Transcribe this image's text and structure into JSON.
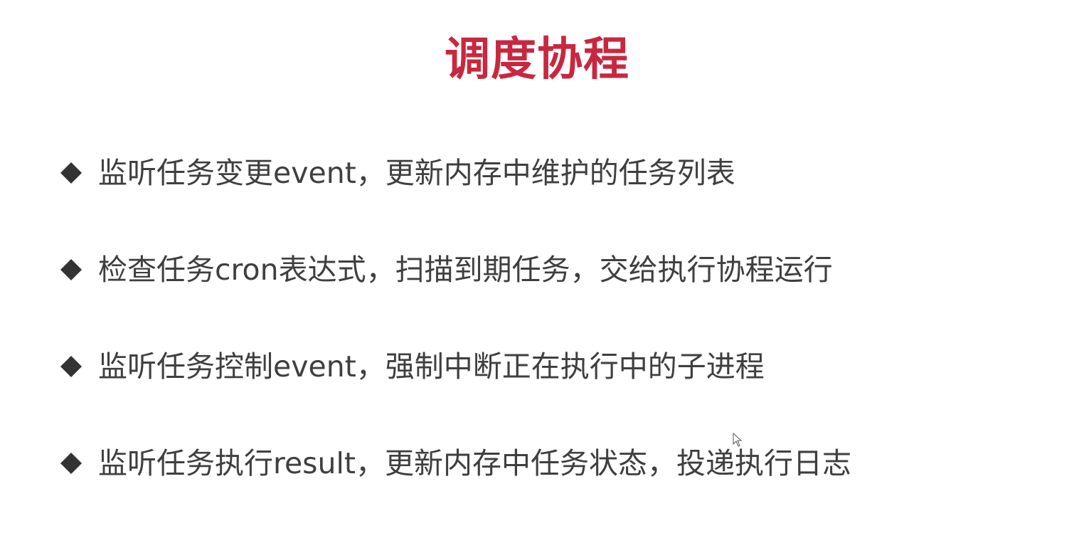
{
  "slide": {
    "title": "调度协程",
    "title_color": "#c8283f",
    "bullet_icon": "diamond-bullet-icon",
    "bullet_color": "#333333",
    "bullets": [
      "监听任务变更event，更新内存中维护的任务列表",
      "检查任务cron表达式，扫描到期任务，交给执行协程运行",
      "监听任务控制event，强制中断正在执行中的子进程",
      "监听任务执行result，更新内存中任务状态，投递执行日志"
    ]
  }
}
